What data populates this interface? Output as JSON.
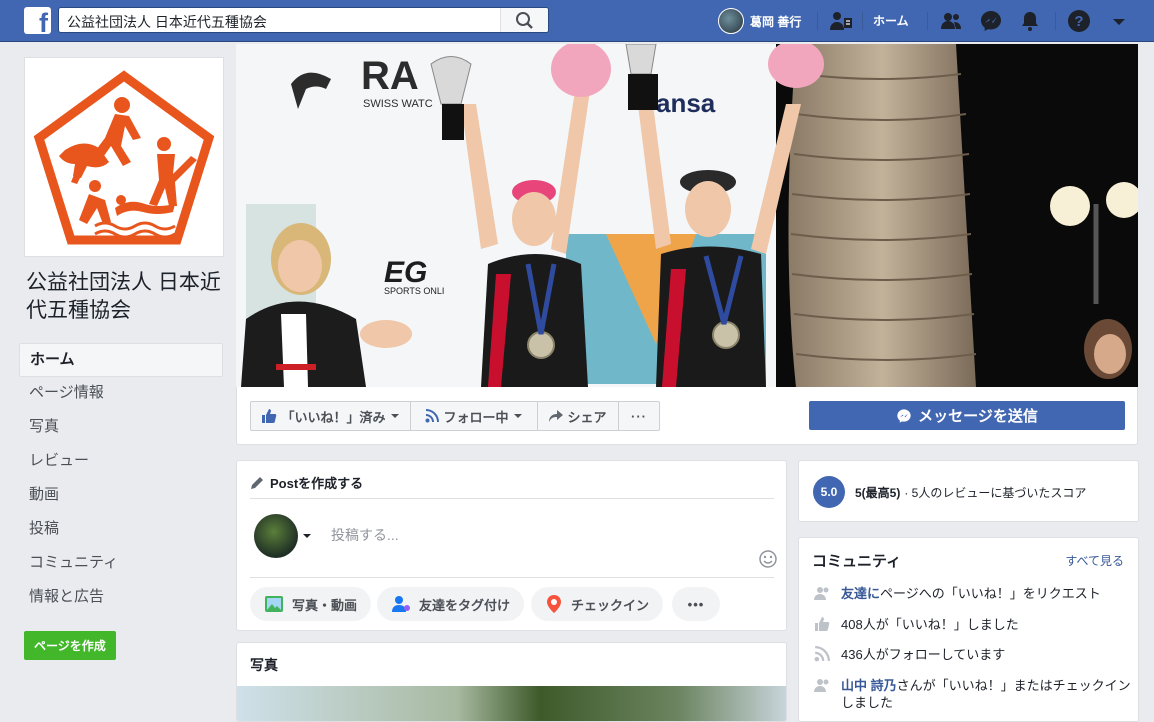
{
  "topbar": {
    "logo": "f",
    "search_value": "公益社団法人 日本近代五種協会",
    "user_name": "葛岡 善行",
    "home_label": "ホーム",
    "icons": [
      "search-icon",
      "find-friends-icon",
      "friends-icon",
      "messenger-icon",
      "bell-icon",
      "help-icon",
      "caret-down-icon"
    ]
  },
  "sidebar": {
    "page_name": "公益社団法人 日本近代五種協会",
    "items": [
      {
        "label": "ホーム"
      },
      {
        "label": "ページ情報"
      },
      {
        "label": "写真"
      },
      {
        "label": "レビュー"
      },
      {
        "label": "動画"
      },
      {
        "label": "投稿"
      },
      {
        "label": "コミュニティ"
      },
      {
        "label": "情報と広告"
      }
    ],
    "create_page_label": "ページを作成"
  },
  "actions": {
    "like_label": "「いいね！」済み",
    "follow_label": "フォロー中",
    "share_label": "シェア",
    "more_label": "···",
    "message_label": "メッセージを送信"
  },
  "composer": {
    "title": "Postを作成する",
    "placeholder": "投稿する...",
    "photo_label": "写真・動画",
    "tag_label": "友達をタグ付け",
    "checkin_label": "チェックイン",
    "more_label": "•••"
  },
  "photos": {
    "title": "写真"
  },
  "reviews": {
    "score": "5.0",
    "max_label": "5(最高5)",
    "desc": "· 5人のレビューに基づいたスコア"
  },
  "community": {
    "title": "コミュニティ",
    "see_all": "すべて見る",
    "rows": [
      {
        "link": "友達に",
        "text": "ページへの「いいね！」をリクエスト"
      },
      {
        "link": "",
        "text": "408人が「いいね！」しました"
      },
      {
        "link": "",
        "text": "436人がフォローしています"
      },
      {
        "link": "山中 詩乃",
        "text": "さんが「いいね！」またはチェックインしました"
      }
    ]
  },
  "cover": {
    "brand_left": "RA",
    "brand_sub": "SWISS WATC",
    "brand_right": "ansa",
    "brand_mid": "EG",
    "brand_mid_sub": "SPORTS ONLI"
  },
  "colors": {
    "brand_blue": "#4267b2",
    "green": "#42b72a",
    "orange": "#e8561d"
  }
}
